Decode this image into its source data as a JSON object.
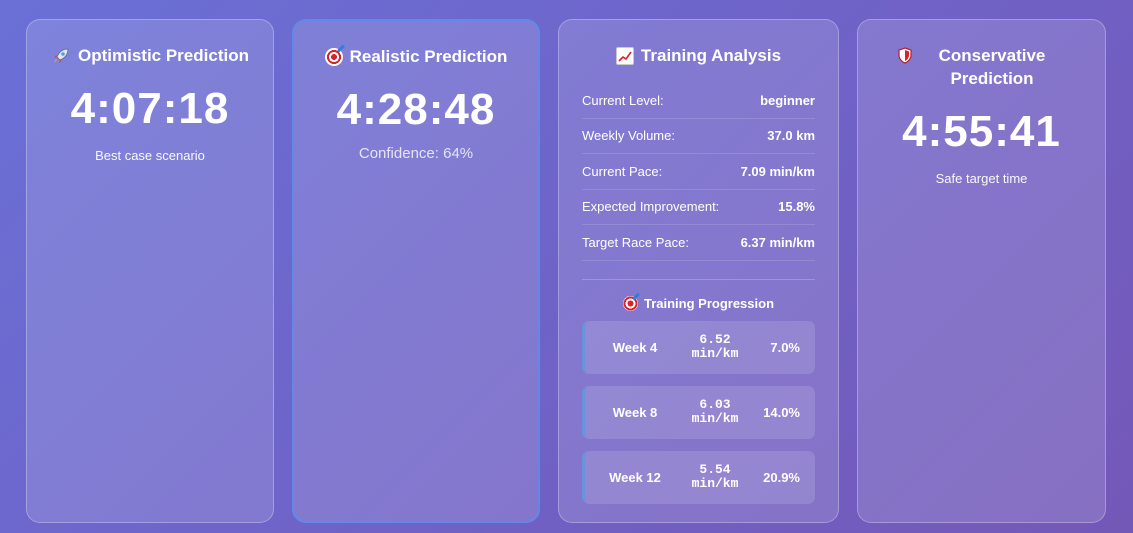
{
  "optimistic": {
    "icon": "rocket-icon",
    "title": "Optimistic Prediction",
    "time": "4:07:18",
    "subtitle": "Best case scenario"
  },
  "realistic": {
    "icon": "target-icon",
    "title": "Realistic Prediction",
    "time": "4:28:48",
    "subtitle": "Confidence: 64%"
  },
  "analysis": {
    "icon": "chart-increasing-icon",
    "title": "Training Analysis",
    "stats": [
      {
        "label": "Current Level:",
        "value": "beginner"
      },
      {
        "label": "Weekly Volume:",
        "value": "37.0 km"
      },
      {
        "label": "Current Pace:",
        "value": "7.09 min/km"
      },
      {
        "label": "Expected Improvement:",
        "value": "15.8%"
      },
      {
        "label": "Target Race Pace:",
        "value": "6.37 min/km"
      }
    ],
    "progression_title": "Training Progression",
    "weeks": [
      {
        "week": "Week 4",
        "pace_value": "6.52",
        "pace_unit": "min/km",
        "percent": "7.0%"
      },
      {
        "week": "Week 8",
        "pace_value": "6.03",
        "pace_unit": "min/km",
        "percent": "14.0%"
      },
      {
        "week": "Week 12",
        "pace_value": "5.54",
        "pace_unit": "min/km",
        "percent": "20.9%"
      }
    ]
  },
  "conservative": {
    "icon": "shield-icon",
    "title": "Conservative Prediction",
    "time": "4:55:41",
    "subtitle": "Safe target time"
  },
  "colors": {
    "background_start": "#6a70d6",
    "background_end": "#7458b8",
    "highlight_border": "#5c8ceb",
    "text": "#ffffff"
  }
}
